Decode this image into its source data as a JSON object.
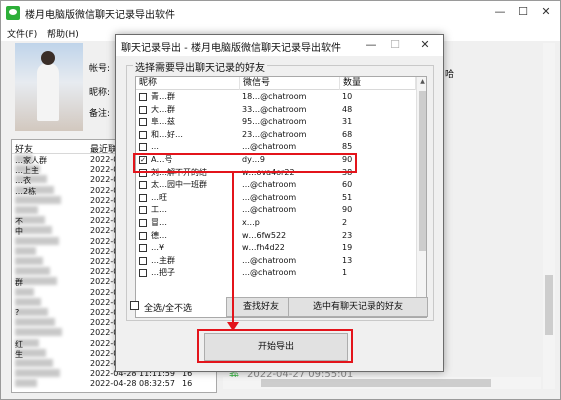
{
  "main_window": {
    "title": "楼月电脑版微信聊天记录导出软件",
    "menu": [
      "文件(F)",
      "帮助(H)"
    ],
    "info_labels": [
      "帐号:",
      "昵称:",
      "备注:"
    ],
    "right_text": "哈",
    "friend_list": {
      "columns": [
        "好友",
        "最近联"
      ],
      "rows": [
        {
          "name": "…家人群",
          "date": "2022-05",
          "num": ""
        },
        {
          "name": "…上主",
          "date": "2022-05",
          "num": ""
        },
        {
          "name": "…衣",
          "date": "2022-05",
          "num": ""
        },
        {
          "name": "…2栋",
          "date": "2022-05",
          "num": ""
        },
        {
          "name": "",
          "date": "2022-05",
          "num": ""
        },
        {
          "name": "",
          "date": "2022-05",
          "num": ""
        },
        {
          "name": "不",
          "date": "2022-05",
          "num": ""
        },
        {
          "name": "中",
          "date": "2022-05",
          "num": ""
        },
        {
          "name": "",
          "date": "2022-05",
          "num": ""
        },
        {
          "name": "",
          "date": "2022-05",
          "num": ""
        },
        {
          "name": "",
          "date": "2022-05",
          "num": ""
        },
        {
          "name": "",
          "date": "2022-05",
          "num": ""
        },
        {
          "name": "群",
          "date": "2022-05",
          "num": ""
        },
        {
          "name": "",
          "date": "2022-05",
          "num": ""
        },
        {
          "name": "",
          "date": "2022-05",
          "num": ""
        },
        {
          "name": "?",
          "date": "2022-05",
          "num": ""
        },
        {
          "name": "",
          "date": "2022-05",
          "num": ""
        },
        {
          "name": "",
          "date": "2022-05",
          "num": ""
        },
        {
          "name": "红",
          "date": "2022-04",
          "num": ""
        },
        {
          "name": "生",
          "date": "2022-04",
          "num": ""
        },
        {
          "name": "",
          "date": "2022-04",
          "num": ""
        },
        {
          "name": "",
          "date": "2022-04-28 11:11:59",
          "num": "16"
        },
        {
          "name": "",
          "date": "2022-04-28 08:32:57",
          "num": "16"
        }
      ]
    },
    "chat_preview": {
      "prefix": "我",
      "text": "2022-04-27 09:55:01"
    }
  },
  "dialog": {
    "title": "聊天记录导出 - 楼月电脑版微信聊天记录导出软件",
    "group_label": "选择需要导出聊天记录的好友",
    "columns": [
      "昵称",
      "微信号",
      "数量"
    ],
    "rows": [
      {
        "checked": false,
        "nick": "青…群",
        "wxid": "18…@chatroom",
        "count": "10"
      },
      {
        "checked": false,
        "nick": "大…群",
        "wxid": "33…@chatroom",
        "count": "48"
      },
      {
        "checked": false,
        "nick": "阜…兹",
        "wxid": "95…@chatroom",
        "count": "31"
      },
      {
        "checked": false,
        "nick": "和…好…",
        "wxid": "23…@chatroom",
        "count": "68"
      },
      {
        "checked": false,
        "nick": "…",
        "wxid": "…@chatroom",
        "count": "85"
      },
      {
        "checked": true,
        "nick": "A…号",
        "wxid": "dy…9",
        "count": "90"
      },
      {
        "checked": false,
        "nick": "刘…解不开的结",
        "wxid": "w…ova4or22",
        "count": "38"
      },
      {
        "checked": false,
        "nick": "太…园中一班群",
        "wxid": "…@chatroom",
        "count": "60"
      },
      {
        "checked": false,
        "nick": "…旺",
        "wxid": "…@chatroom",
        "count": "51"
      },
      {
        "checked": false,
        "nick": "工…",
        "wxid": "…@chatroom",
        "count": "90"
      },
      {
        "checked": false,
        "nick": "冒…",
        "wxid": "x…p",
        "count": "2"
      },
      {
        "checked": false,
        "nick": "德…",
        "wxid": "w…6fw522",
        "count": "23"
      },
      {
        "checked": false,
        "nick": "…¥",
        "wxid": "w…fh4d22",
        "count": "19"
      },
      {
        "checked": false,
        "nick": "…主群",
        "wxid": "…@chatroom",
        "count": "13"
      },
      {
        "checked": false,
        "nick": "…把子",
        "wxid": "…@chatroom",
        "count": "1"
      }
    ],
    "select_all_label": "全选/全不选",
    "find_friend_button": "查找好友",
    "select_with_records_button": "选中有聊天记录的好友",
    "start_export_button": "开始导出"
  },
  "colors": {
    "highlight": "#e3141b",
    "wechat_green": "#2daf39"
  }
}
